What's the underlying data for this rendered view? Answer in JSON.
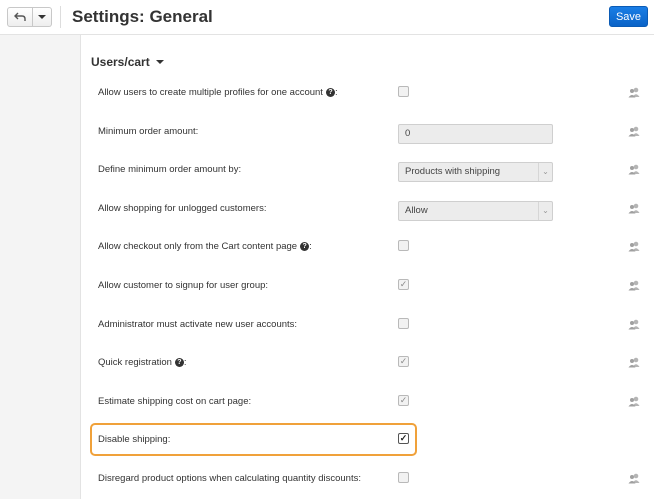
{
  "header": {
    "title": "Settings: General",
    "save_label": "Save"
  },
  "section": {
    "title": "Users/cart"
  },
  "settings": [
    {
      "label": "Allow users to create multiple profiles for one account",
      "help": true,
      "help_suffix": ":",
      "control": "checkbox",
      "checked": false
    },
    {
      "label": "Minimum order amount:",
      "control": "input",
      "value": "0"
    },
    {
      "label": "Define minimum order amount by:",
      "control": "select",
      "value": "Products with shipping"
    },
    {
      "label": "Allow shopping for unlogged customers:",
      "control": "select",
      "value": "Allow"
    },
    {
      "label": "Allow checkout only from the Cart content page",
      "help": true,
      "help_suffix": ":",
      "control": "checkbox",
      "checked": false
    },
    {
      "label": "Allow customer to signup for user group:",
      "control": "checkbox",
      "checked": true
    },
    {
      "label": "Administrator must activate new user accounts:",
      "control": "checkbox",
      "checked": false
    },
    {
      "label": "Quick registration",
      "help": true,
      "help_suffix": ":",
      "control": "checkbox",
      "checked": true
    },
    {
      "label": "Estimate shipping cost on cart page:",
      "control": "checkbox",
      "checked": true
    },
    {
      "label": "Disable shipping:",
      "control": "checkbox",
      "checked": true,
      "highlighted": true
    },
    {
      "label": "Disregard product options when calculating quantity discounts:",
      "control": "checkbox",
      "checked": false
    }
  ],
  "colors": {
    "accent": "#0a63c7",
    "highlight": "#f0a13a"
  }
}
